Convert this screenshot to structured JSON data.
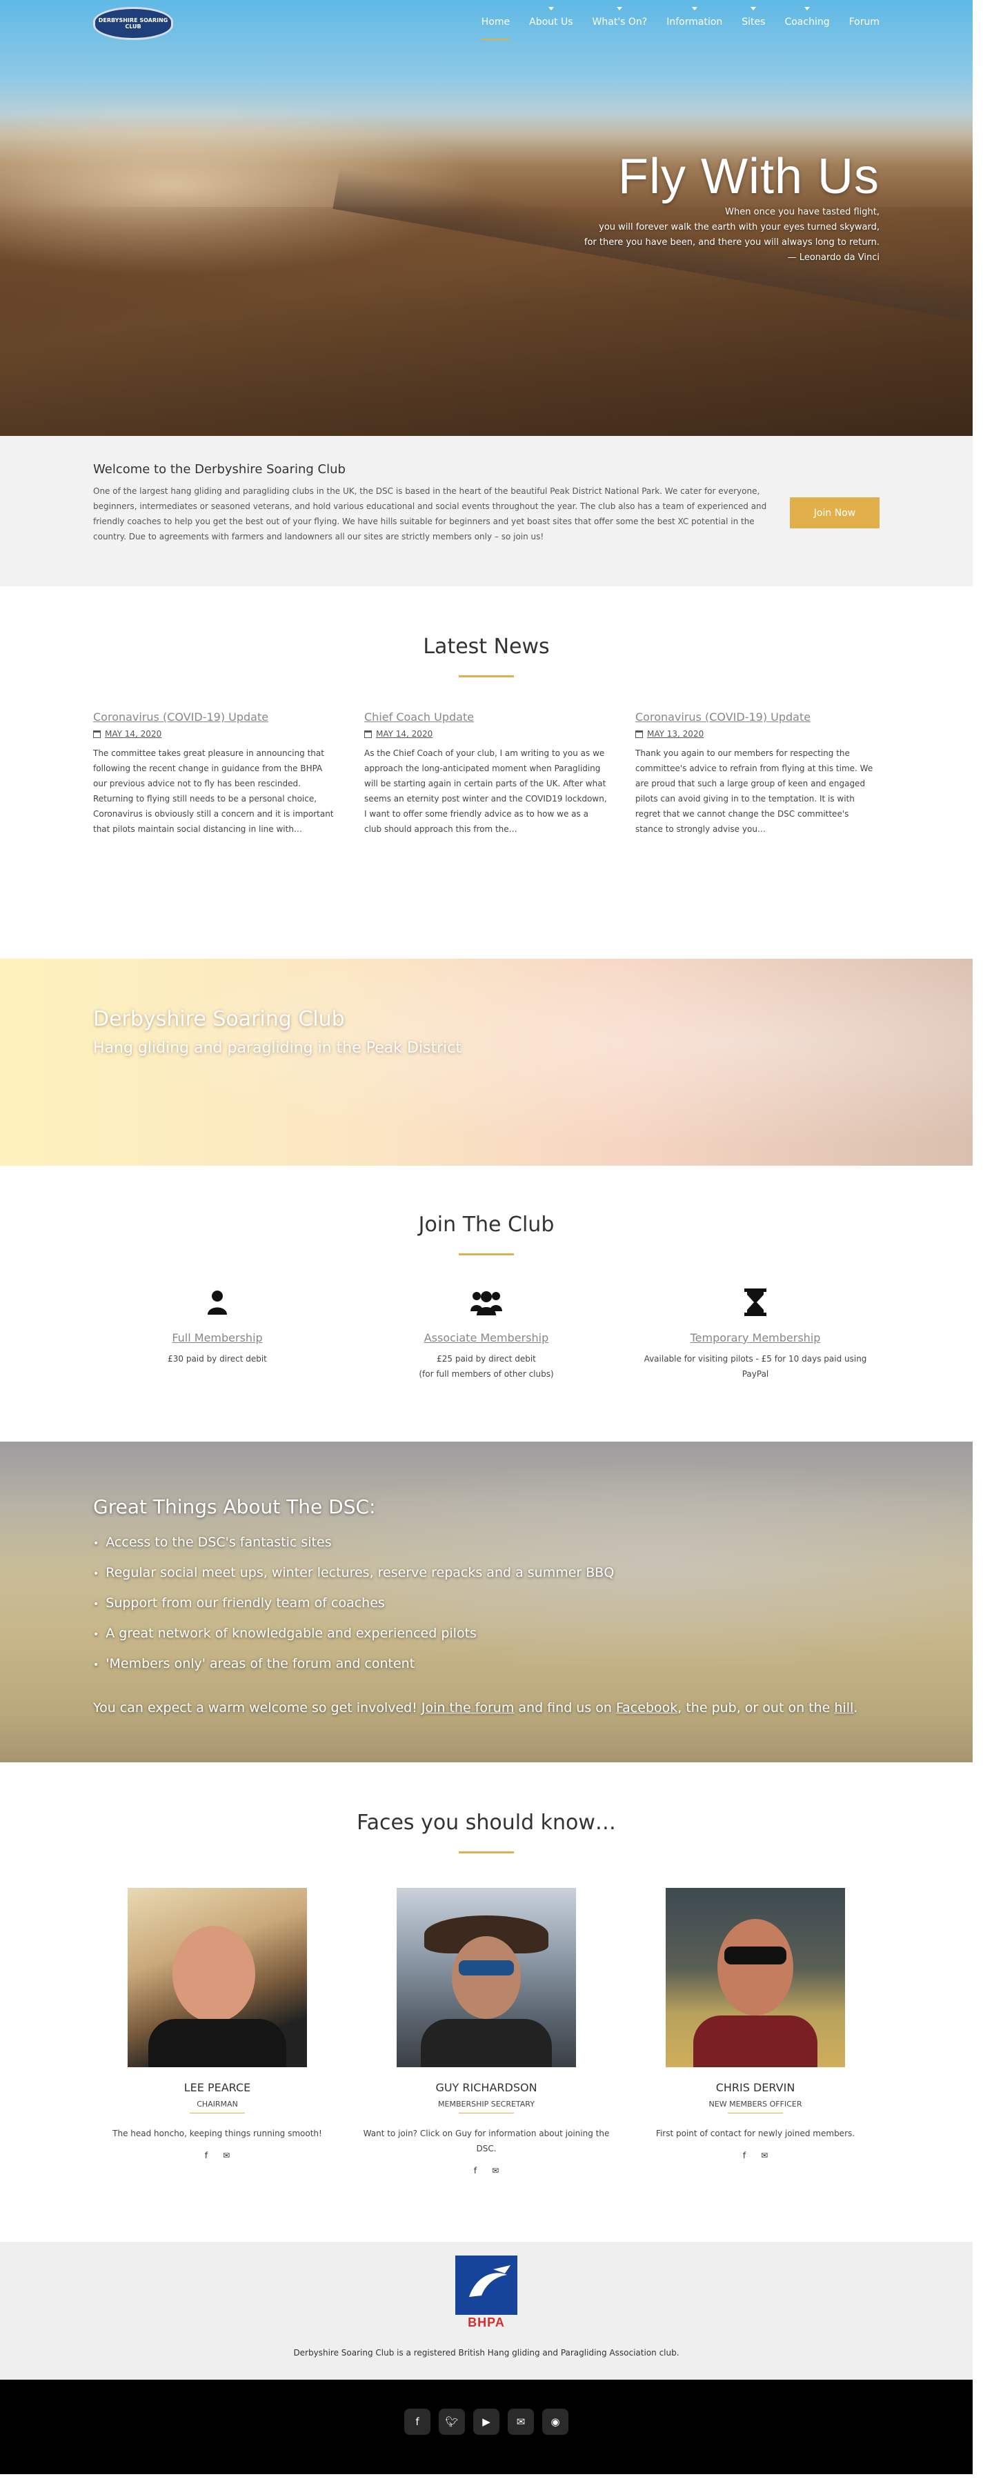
{
  "site": {
    "logo_text": "DERBYSHIRE SOARING CLUB"
  },
  "nav": {
    "items": [
      {
        "label": "Home"
      },
      {
        "label": "About Us"
      },
      {
        "label": "What's On?"
      },
      {
        "label": "Information"
      },
      {
        "label": "Sites"
      },
      {
        "label": "Coaching"
      },
      {
        "label": "Forum"
      }
    ]
  },
  "hero": {
    "title": "Fly With Us",
    "quote_lines": [
      "When once you have tasted flight,",
      "you will forever walk the earth with your eyes turned skyward,",
      "for there you have been, and there you will always long to return.",
      "— Leonardo da Vinci"
    ]
  },
  "welcome": {
    "title": "Welcome to the Derbyshire Soaring Club",
    "text": "One of the largest hang gliding and paragliding clubs in the UK, the DSC is based in the heart of the beautiful Peak District National Park. We cater for everyone, beginners, intermediates or seasoned veterans, and hold various educational and social events throughout the year. The club also has a team of experienced and friendly coaches to help you get the best out of your flying. We have hills suitable for beginners and yet boast sites that offer some the best XC potential in the country. Due to agreements with farmers and landowners all our sites are strictly members only – so join us!",
    "button": "Join Now"
  },
  "news": {
    "title": "Latest News",
    "items": [
      {
        "title": "Coronavirus (COVID-19) Update",
        "date": "MAY 14, 2020",
        "excerpt": "The committee takes great pleasure in announcing that following the recent change in guidance from the BHPA our previous advice not to fly has been rescinded. Returning to flying still needs to be a personal choice, Coronavirus is obviously still a concern and it is important that pilots maintain social distancing in line with…"
      },
      {
        "title": "Chief Coach Update",
        "date": "MAY 14, 2020",
        "excerpt": "As the Chief Coach of your club, I am writing to you as we approach the long-anticipated moment when Paragliding will be starting again in certain parts of the UK.  After what seems an eternity post winter and the COVID19 lockdown, I want to offer some friendly advice as to how we as a club should approach this from the…"
      },
      {
        "title": "Coronavirus (COVID-19) Update",
        "date": "MAY 13, 2020",
        "excerpt": "Thank you again to our members for respecting the committee's advice to refrain from flying at this time. We are proud that such a large group of keen and engaged pilots can avoid giving in to the temptation. It is with regret that we cannot change the DSC committee's stance to strongly advise you…"
      }
    ]
  },
  "banner": {
    "title": "Derbyshire Soaring Club",
    "subtitle": "Hang gliding and paragliding in the Peak District"
  },
  "join": {
    "title": "Join The Club",
    "items": [
      {
        "icon": "user-icon",
        "title": "Full Membership",
        "lines": [
          "£30 paid by direct debit"
        ]
      },
      {
        "icon": "users-icon",
        "title": "Associate Membership",
        "lines": [
          "£25 paid by direct debit",
          "(for full members of other clubs)"
        ]
      },
      {
        "icon": "hourglass-icon",
        "title": "Temporary Membership",
        "lines": [
          "Available for visiting pilots - £5 for 10 days paid using PayPal"
        ]
      }
    ]
  },
  "great": {
    "title": "Great Things About The DSC:",
    "items": [
      "Access to the DSC's fantastic sites",
      "Regular social meet ups, winter lectures, reserve repacks and a summer BBQ",
      "Support from our friendly team of coaches",
      "A great network of knowledgable and experienced pilots",
      "'Members only' areas of the forum and content"
    ],
    "footer_prefix": "You can expect a warm welcome so get involved!  ",
    "footer_link1": "Join the forum",
    "footer_mid1": " and find us on ",
    "footer_link2": "Facebook",
    "footer_mid2": ", the pub, or out on the ",
    "footer_link3": "hill",
    "footer_suffix": "."
  },
  "faces": {
    "title": "Faces you should know…",
    "people": [
      {
        "name": "LEE PEARCE",
        "role": "CHAIRMAN",
        "text": "The head honcho, keeping things running smooth!"
      },
      {
        "name": "GUY RICHARDSON",
        "role": "MEMBERSHIP SECRETARY",
        "text": "Want to join? Click on Guy for information about joining the DSC."
      },
      {
        "name": "CHRIS DERVIN",
        "role": "NEW MEMBERS OFFICER",
        "text": "First point of contact for newly joined members."
      }
    ]
  },
  "bhpa": {
    "logo_text": "BHPA",
    "text": "Derbyshire Soaring Club is a registered British Hang gliding and Paragliding Association club."
  },
  "footer": {
    "social": [
      "facebook-icon",
      "twitter-icon",
      "youtube-icon",
      "email-icon",
      "rss-icon"
    ]
  },
  "colors": {
    "accent": "#e2b04a",
    "footer_bg": "#000000",
    "bhpa_blue": "#16449a",
    "bhpa_red": "#d82c2c"
  }
}
